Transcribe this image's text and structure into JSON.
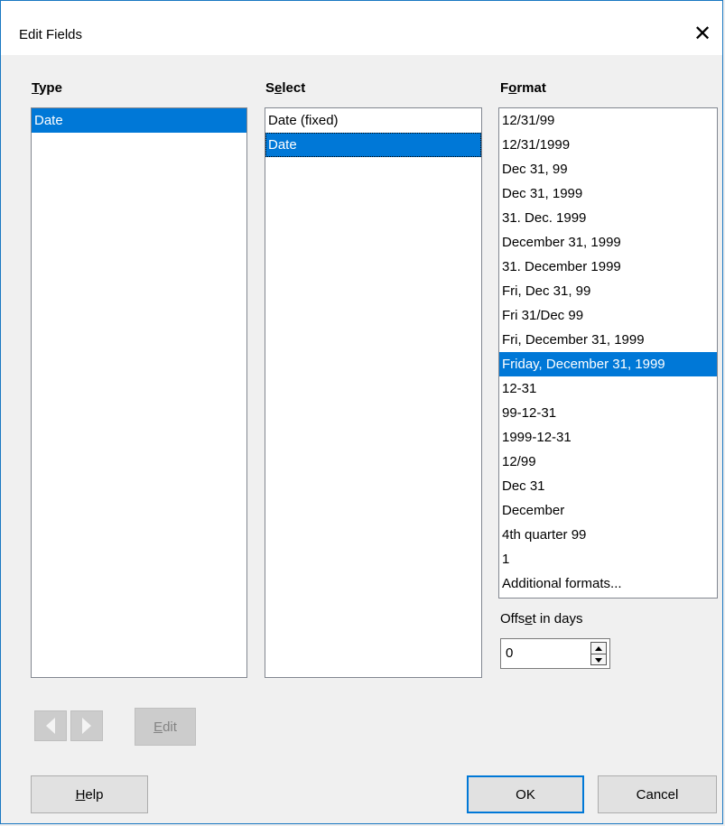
{
  "dialog": {
    "title": "Edit Fields",
    "close_glyph": "✕"
  },
  "type_column": {
    "label_mnemonic": "T",
    "label_rest": "ype",
    "items": [
      "Date"
    ],
    "selected_index": 0
  },
  "select_column": {
    "label_first": "S",
    "label_mnemonic": "e",
    "label_rest": "lect",
    "items": [
      "Date (fixed)",
      "Date"
    ],
    "selected_index": 1
  },
  "format_column": {
    "label_first": "F",
    "label_mnemonic": "o",
    "label_rest": "rmat",
    "items": [
      "12/31/99",
      "12/31/1999",
      "Dec 31, 99",
      "Dec 31, 1999",
      "31. Dec. 1999",
      "December 31, 1999",
      "31. December 1999",
      "Fri, Dec 31, 99",
      "Fri 31/Dec 99",
      "Fri, December 31, 1999",
      "Friday, December 31, 1999",
      "12-31",
      "99-12-31",
      "1999-12-31",
      "12/99",
      "Dec 31",
      "December",
      "4th quarter 99",
      "1",
      "Additional formats..."
    ],
    "selected_index": 10
  },
  "offset": {
    "label_first": "Offs",
    "label_mnemonic": "e",
    "label_rest": "t in days",
    "value": "0"
  },
  "buttons": {
    "prev_icon": "triangle-left",
    "next_icon": "triangle-right",
    "edit_mnemonic": "E",
    "edit_rest": "dit",
    "help_mnemonic": "H",
    "help_rest": "elp",
    "ok": "OK",
    "cancel": "Cancel"
  },
  "colors": {
    "accent": "#0078d7",
    "window_border": "#1a78c2",
    "face": "#f0f0f0"
  }
}
